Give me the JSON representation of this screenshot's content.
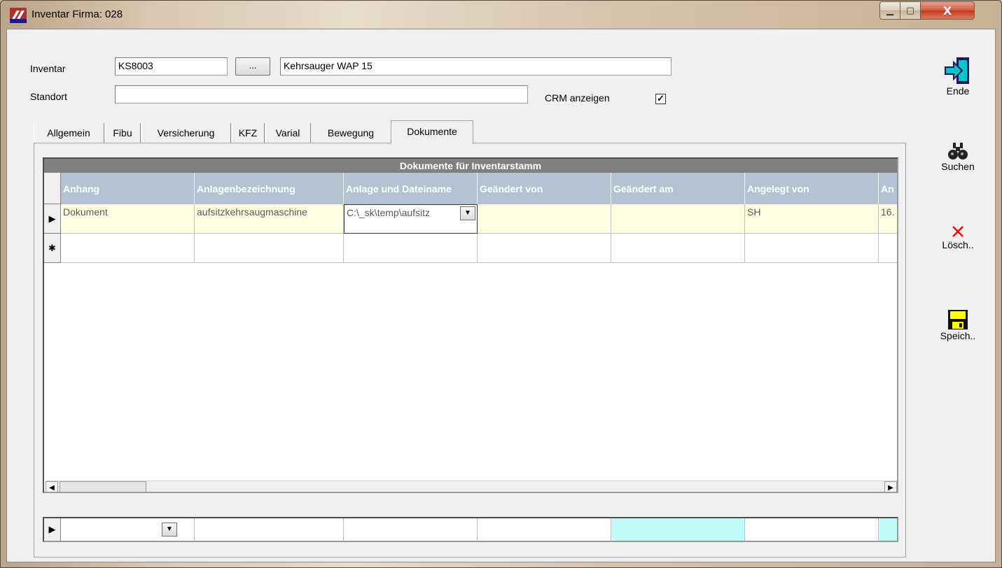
{
  "window": {
    "title": "Inventar Firma: 028",
    "controls": {
      "minimize": "▁",
      "maximize": "▢",
      "close": "X"
    }
  },
  "form": {
    "inventar_label": "Inventar",
    "inventar_number": "KS8003",
    "lookup_button": "...",
    "inventar_name": "Kehrsauger WAP 15",
    "standort_label": "Standort",
    "standort_value": "",
    "crm_label": "CRM anzeigen",
    "crm_checked": "✓"
  },
  "tabs": [
    "Allgemein",
    "Fibu",
    "Versicherung",
    "KFZ",
    "Varial",
    "Bewegung",
    "Dokumente"
  ],
  "active_tab": "Dokumente",
  "grid": {
    "caption": "Dokumente für Inventarstamm",
    "columns": [
      "Anhang",
      "Anlagenbezeichnung",
      "Anlage und Dateiname",
      "Geändert von",
      "Geändert am",
      "Angelegt von",
      "An"
    ],
    "rows": [
      {
        "indicator": "▶",
        "cells": [
          "Dokument",
          "aufsitzkehrsaugmaschine",
          "C:\\_sk\\temp\\aufsitz",
          "",
          "",
          "SH",
          "16."
        ]
      }
    ],
    "new_row_indicator": "✱",
    "scroll_left": "◀",
    "scroll_right": "▶"
  },
  "filter_row": {
    "indicator": "▶",
    "dropdown_arrow": "▼"
  },
  "toolbar": {
    "ende": "Ende",
    "suchen": "Suchen",
    "loeschen": "Lösch..",
    "speichern": "Speich.."
  },
  "colors": {
    "header_bg": "#b4c3d2",
    "row_highlight": "#ffffe1",
    "filter_highlight": "#c3fbfb",
    "delete_red": "#ff0000",
    "save_yellow": "#ffff00"
  }
}
